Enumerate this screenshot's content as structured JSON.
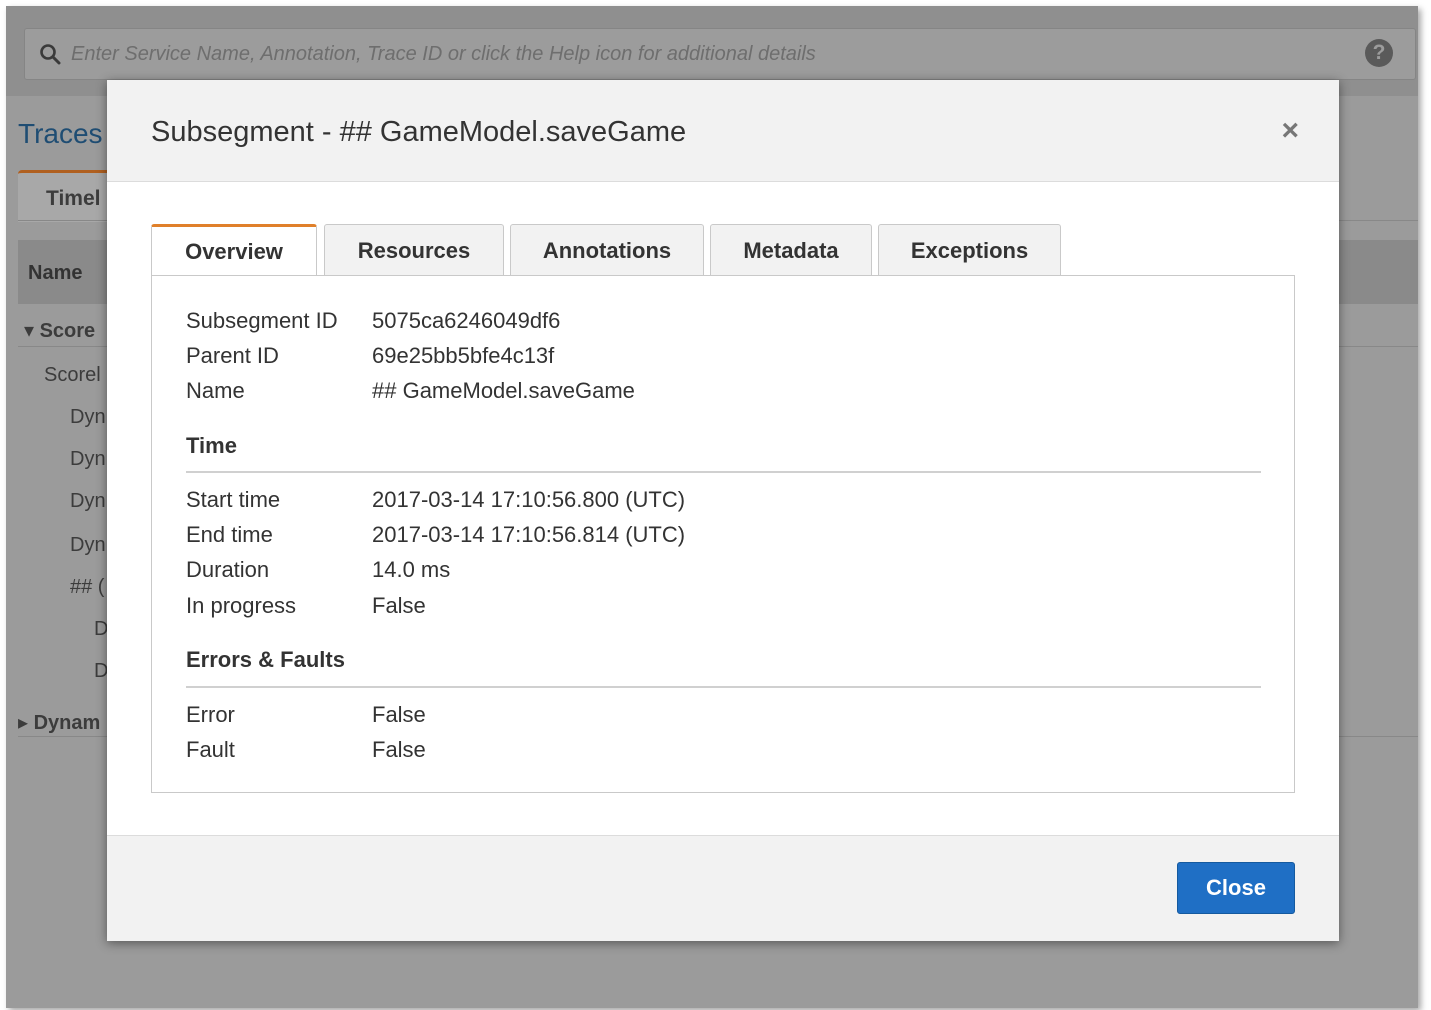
{
  "background": {
    "search_placeholder": "Enter Service Name, Annotation, Trace ID or click the Help icon for additional details",
    "help_icon_glyph": "?",
    "traces_title": "Traces",
    "timeline_tab": "Timel",
    "name_header": "Name",
    "tree_rows": [
      {
        "text": "▾ Score",
        "bold": true
      },
      {
        "text": "Scorel",
        "bold": false
      },
      {
        "text": "Dyn",
        "bold": false
      },
      {
        "text": "Dyn",
        "bold": false
      },
      {
        "text": "Dyn",
        "bold": false
      },
      {
        "text": "Dyn",
        "bold": false
      },
      {
        "text": "## (",
        "bold": false
      },
      {
        "text": "D",
        "bold": false
      },
      {
        "text": "D",
        "bold": false
      },
      {
        "text": "▸ Dynam",
        "bold": true
      }
    ]
  },
  "modal": {
    "title": "Subsegment - ## GameModel.saveGame",
    "close_x": "×",
    "tabs": [
      "Overview",
      "Resources",
      "Annotations",
      "Metadata",
      "Exceptions"
    ],
    "active_tab": "Overview",
    "overview": {
      "fields": [
        {
          "key": "Subsegment ID",
          "value": "5075ca6246049df6"
        },
        {
          "key": "Parent ID",
          "value": "69e25bb5bfe4c13f"
        },
        {
          "key": "Name",
          "value": "## GameModel.saveGame"
        }
      ],
      "time_title": "Time",
      "time_fields": [
        {
          "key": "Start time",
          "value": "2017-03-14 17:10:56.800 (UTC)"
        },
        {
          "key": "End time",
          "value": "2017-03-14 17:10:56.814 (UTC)"
        },
        {
          "key": "Duration",
          "value": "14.0 ms"
        },
        {
          "key": "In progress",
          "value": "False"
        }
      ],
      "errors_title": "Errors & Faults",
      "error_fields": [
        {
          "key": "Error",
          "value": "False"
        },
        {
          "key": "Fault",
          "value": "False"
        }
      ]
    },
    "close_button": "Close"
  },
  "colors": {
    "accent_tab": "#e0802a",
    "primary_button": "#1f6fc5"
  }
}
